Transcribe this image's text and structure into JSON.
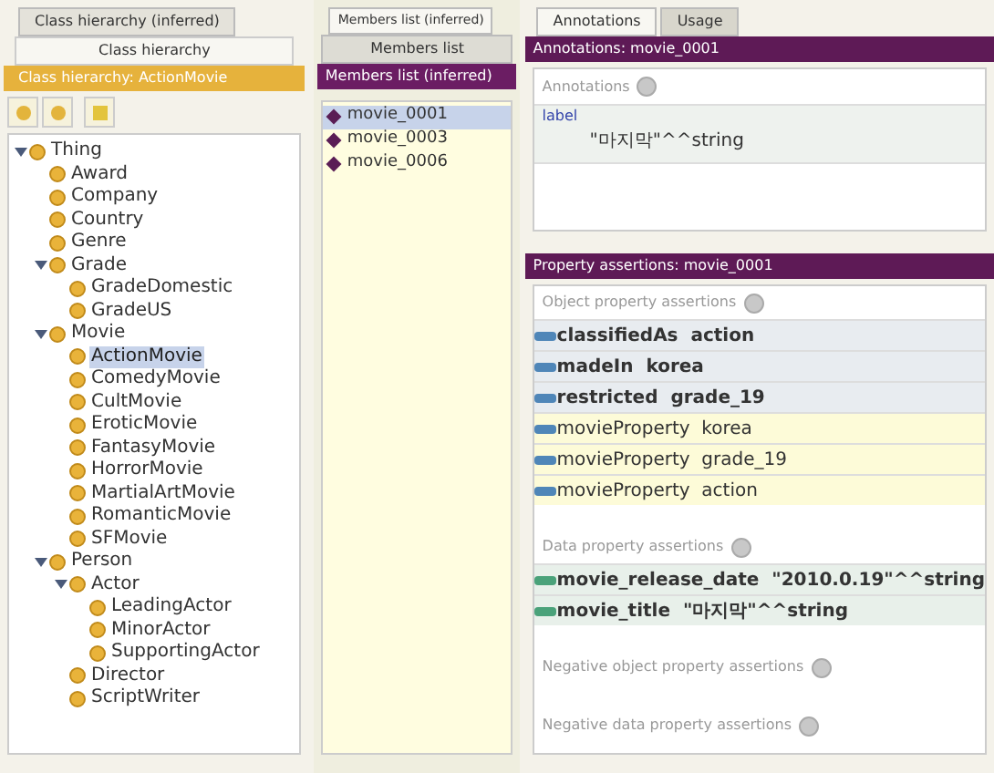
{
  "class_panel": {
    "tabs": [
      {
        "label": "Class hierarchy (inferred)",
        "selected": false
      }
    ],
    "subtab": "Class hierarchy",
    "header": "Class hierarchy: ActionMovie",
    "tree": [
      {
        "label": "Thing",
        "expanded": true,
        "selected": false,
        "children": [
          {
            "label": "Award",
            "selected": false
          },
          {
            "label": "Company",
            "selected": false
          },
          {
            "label": "Country",
            "selected": false
          },
          {
            "label": "Genre",
            "selected": false
          },
          {
            "label": "Grade",
            "expanded": true,
            "selected": false,
            "children": [
              {
                "label": "GradeDomestic",
                "selected": false
              },
              {
                "label": "GradeUS",
                "selected": false
              }
            ]
          },
          {
            "label": "Movie",
            "expanded": true,
            "selected": false,
            "children": [
              {
                "label": "ActionMovie",
                "selected": true
              },
              {
                "label": "ComedyMovie",
                "selected": false
              },
              {
                "label": "CultMovie",
                "selected": false
              },
              {
                "label": "EroticMovie",
                "selected": false
              },
              {
                "label": "FantasyMovie",
                "selected": false
              },
              {
                "label": "HorrorMovie",
                "selected": false
              },
              {
                "label": "MartialArtMovie",
                "selected": false
              },
              {
                "label": "RomanticMovie",
                "selected": false
              },
              {
                "label": "SFMovie",
                "selected": false
              }
            ]
          },
          {
            "label": "Person",
            "expanded": true,
            "selected": false,
            "children": [
              {
                "label": "Actor",
                "expanded": true,
                "selected": false,
                "children": [
                  {
                    "label": "LeadingActor",
                    "selected": false
                  },
                  {
                    "label": "MinorActor",
                    "selected": false
                  },
                  {
                    "label": "SupportingActor",
                    "selected": false
                  }
                ]
              },
              {
                "label": "Director",
                "selected": false
              },
              {
                "label": "ScriptWriter",
                "selected": false
              }
            ]
          }
        ]
      }
    ]
  },
  "members_panel": {
    "tab": "Members list (inferred)",
    "subtab": "Members list",
    "header": "Members list (inferred)",
    "items": [
      {
        "label": "movie_0001",
        "selected": true
      },
      {
        "label": "movie_0003",
        "selected": false
      },
      {
        "label": "movie_0006",
        "selected": false
      }
    ]
  },
  "right_panel": {
    "tabs": [
      {
        "label": "Annotations",
        "selected": true
      },
      {
        "label": "Usage",
        "selected": false
      }
    ],
    "annotations": {
      "header": "Annotations: movie_0001",
      "section": "Annotations",
      "property": "label",
      "value": "\"마지막\"^^string"
    },
    "assertions": {
      "header": "Property assertions: movie_0001",
      "sections": [
        {
          "title": "Object property assertions",
          "rows": [
            {
              "kind": "object",
              "text": "classifiedAs  action"
            },
            {
              "kind": "object",
              "text": "madeIn  korea"
            },
            {
              "kind": "object",
              "text": "restricted  grade_19"
            },
            {
              "kind": "inferred",
              "text": "movieProperty  korea"
            },
            {
              "kind": "inferred",
              "text": "movieProperty  grade_19"
            },
            {
              "kind": "inferred",
              "text": "movieProperty  action"
            }
          ]
        },
        {
          "title": "Data property assertions",
          "rows": [
            {
              "kind": "data",
              "text": "movie_release_date  \"2010.0.19\"^^string"
            },
            {
              "kind": "data",
              "text": "movie_title  \"마지막\"^^string"
            }
          ]
        },
        {
          "title": "Negative object property assertions"
        },
        {
          "title": "Negative data property assertions"
        }
      ]
    }
  }
}
